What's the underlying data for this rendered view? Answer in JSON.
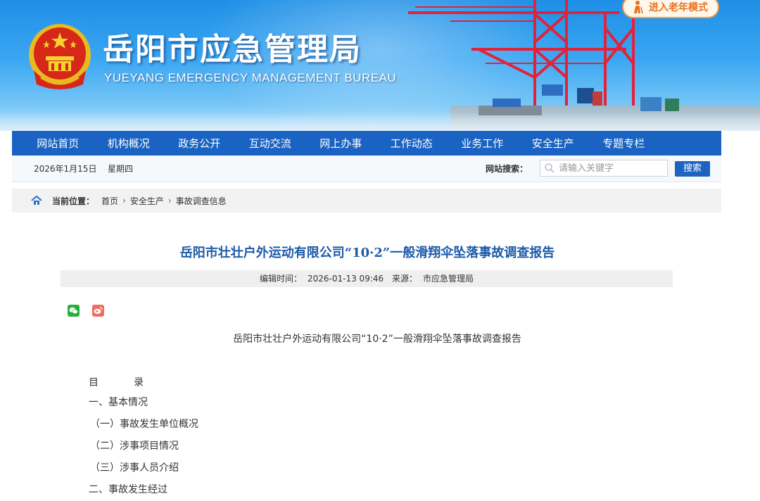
{
  "header": {
    "title_cn": "岳阳市应急管理局",
    "title_en": "YUEYANG EMERGENCY MANAGEMENT BUREAU",
    "elder_mode_label": "进入老年模式"
  },
  "nav": {
    "items": [
      "网站首页",
      "机构概况",
      "政务公开",
      "互动交流",
      "网上办事",
      "工作动态",
      "业务工作",
      "安全生产",
      "专题专栏"
    ]
  },
  "infobar": {
    "date": "2026年1月15日",
    "weekday": "星期四",
    "search_label": "网站搜索：",
    "search_placeholder": "请输入关键字",
    "search_button": "搜索"
  },
  "breadcrumb": {
    "label": "当前位置：",
    "items": [
      "首页",
      "安全生产",
      "事故调查信息"
    ]
  },
  "article": {
    "title": "岳阳市壮壮户外运动有限公司“10·2”一般滑翔伞坠落事故调查报告",
    "meta_edit_label": "编辑时间：",
    "meta_edit_time": "2026-01-13 09:46",
    "meta_source_label": "来源：",
    "meta_source": "市应急管理局",
    "body_title": "岳阳市壮壮户外运动有限公司“10·2”一般滑翔伞坠落事故调查报告",
    "toc_head_1": "目",
    "toc_head_2": "录",
    "toc": [
      "一、基本情况",
      "（一）事故发生单位概况",
      "（二）涉事项目情况",
      "（三）涉事人员介绍",
      "二、事故发生经过"
    ]
  },
  "colors": {
    "nav_bg": "#1a63c2",
    "title_blue": "#1c5aa8",
    "elder_orange": "#f29b4a"
  }
}
